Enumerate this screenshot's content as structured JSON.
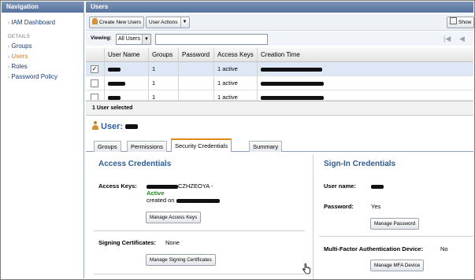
{
  "navigation": {
    "title": "Navigation",
    "dashboard": "IAM Dashboard",
    "section": "DETAILS",
    "items": [
      "Groups",
      "Users",
      "Roles",
      "Password Policy"
    ],
    "active": "Users"
  },
  "users_panel": {
    "title": "Users",
    "toolbar": {
      "create_new_users": "Create New Users",
      "user_actions": "User Actions",
      "show_hide": "Show"
    },
    "viewing_label": "Viewing:",
    "filter_value": "All Users",
    "columns": [
      "User Name",
      "Groups",
      "Password",
      "Access Keys",
      "Creation Time"
    ],
    "rows": [
      {
        "groups": "1",
        "password": "",
        "access_keys": "1 active",
        "checked": true
      },
      {
        "groups": "1",
        "password": "",
        "access_keys": "1 active",
        "checked": false
      },
      {
        "groups": "1",
        "password": "",
        "access_keys": "1 active",
        "checked": false
      }
    ],
    "selection_status": "1 User selected"
  },
  "user_detail": {
    "title_prefix": "User:",
    "tabs": [
      "Groups",
      "Permissions",
      "Security Credentials",
      "Summary"
    ],
    "active_tab": "Security Credentials",
    "access_credentials": {
      "heading": "Access Credentials",
      "access_keys_label": "Access Keys:",
      "access_key_suffix": "CZHZEOYA -",
      "status": "Active",
      "created_on": "created on",
      "manage_access_keys": "Manage Access Keys",
      "signing_certs_label": "Signing Certificates:",
      "signing_certs_value": "None",
      "manage_signing_certs": "Manage Signing Certificates"
    },
    "signin_credentials": {
      "heading": "Sign-In Credentials",
      "user_name_label": "User name:",
      "password_label": "Password:",
      "password_value": "Yes",
      "manage_password": "Manage Password",
      "mfa_label": "Multi-Factor Authentication Device:",
      "mfa_value": "No",
      "manage_mfa": "Manage MFA Device"
    }
  },
  "colors": {
    "header_blue": "#56729d",
    "heading_blue": "#2f5d95",
    "active_orange": "#e07b00",
    "active_green": "#1d8a1d"
  }
}
